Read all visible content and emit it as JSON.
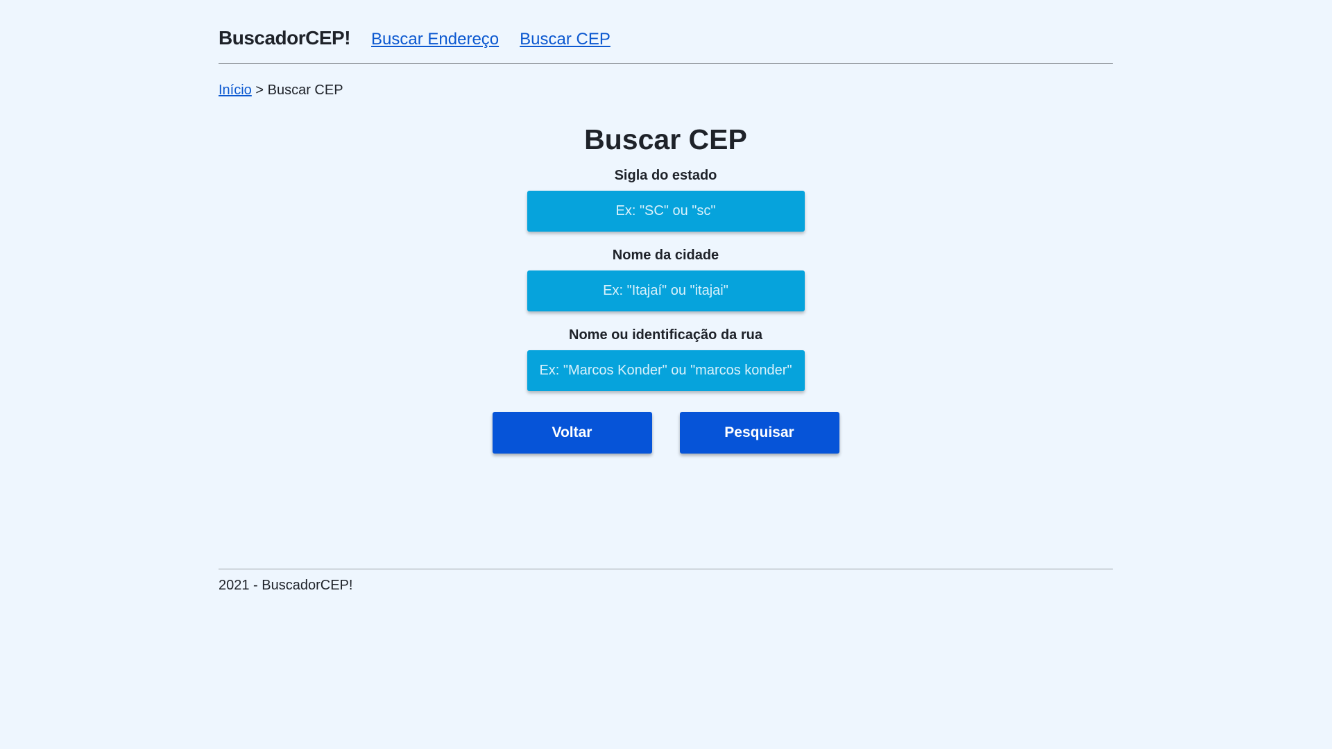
{
  "header": {
    "brand": "BuscadorCEP!",
    "nav": [
      {
        "label": "Buscar Endereço"
      },
      {
        "label": "Buscar CEP"
      }
    ]
  },
  "breadcrumb": {
    "home": "Início",
    "separator": " > ",
    "current": "Buscar CEP"
  },
  "page": {
    "title": "Buscar CEP"
  },
  "form": {
    "state": {
      "label": "Sigla do estado",
      "placeholder": "Ex: \"SC\" ou \"sc\"",
      "value": ""
    },
    "city": {
      "label": "Nome da cidade",
      "placeholder": "Ex: \"Itajaí\" ou \"itajai\"",
      "value": ""
    },
    "street": {
      "label": "Nome ou identificação da rua",
      "placeholder": "Ex: \"Marcos Konder\" ou \"marcos konder\"",
      "value": ""
    },
    "back_label": "Voltar",
    "search_label": "Pesquisar"
  },
  "footer": {
    "text": "2021 - BuscadorCEP!"
  },
  "colors": {
    "background": "#eef6fe",
    "input_bg": "#06a3dc",
    "button_bg": "#0654d8",
    "link": "#0b58d0"
  }
}
